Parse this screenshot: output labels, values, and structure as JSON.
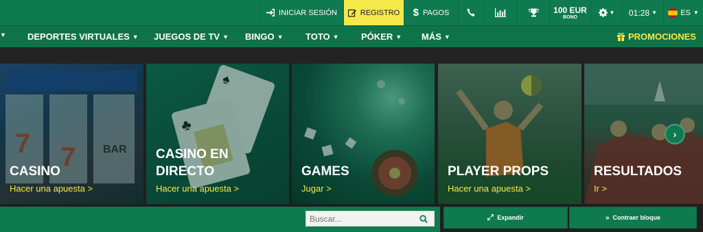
{
  "topbar": {
    "login": "INICIAR SESIÓN",
    "register": "REGISTRO",
    "payments": "PAGOS",
    "bonus_amount": "100 EUR",
    "bonus_label": "BONO",
    "time": "01:28",
    "language": "ES"
  },
  "nav": {
    "items": [
      {
        "label": "DEPORTES VIRTUALES"
      },
      {
        "label": "JUEGOS DE TV"
      },
      {
        "label": "BINGO"
      },
      {
        "label": "TOTO"
      },
      {
        "label": "PÓKER"
      },
      {
        "label": "MÁS"
      }
    ],
    "promotions": "PROMOCIONES"
  },
  "tiles": [
    {
      "title": "CASINO",
      "link": "Hacer una apuesta >"
    },
    {
      "title_line1": "CASINO EN",
      "title_line2": "DIRECTO",
      "link": "Hacer una apuesta >"
    },
    {
      "title": "GAMES",
      "link": "Jugar >"
    },
    {
      "title": "PLAYER PROPS",
      "link": "Hacer una apuesta >"
    },
    {
      "title": "RESULTADOS",
      "link": "Ir >"
    }
  ],
  "search": {
    "placeholder": "Buscar..."
  },
  "panel": {
    "expand": "Expandir",
    "collapse": "Contraer bloque"
  },
  "colors": {
    "brand_green": "#0f7a4f",
    "accent_yellow": "#f5e94a"
  }
}
